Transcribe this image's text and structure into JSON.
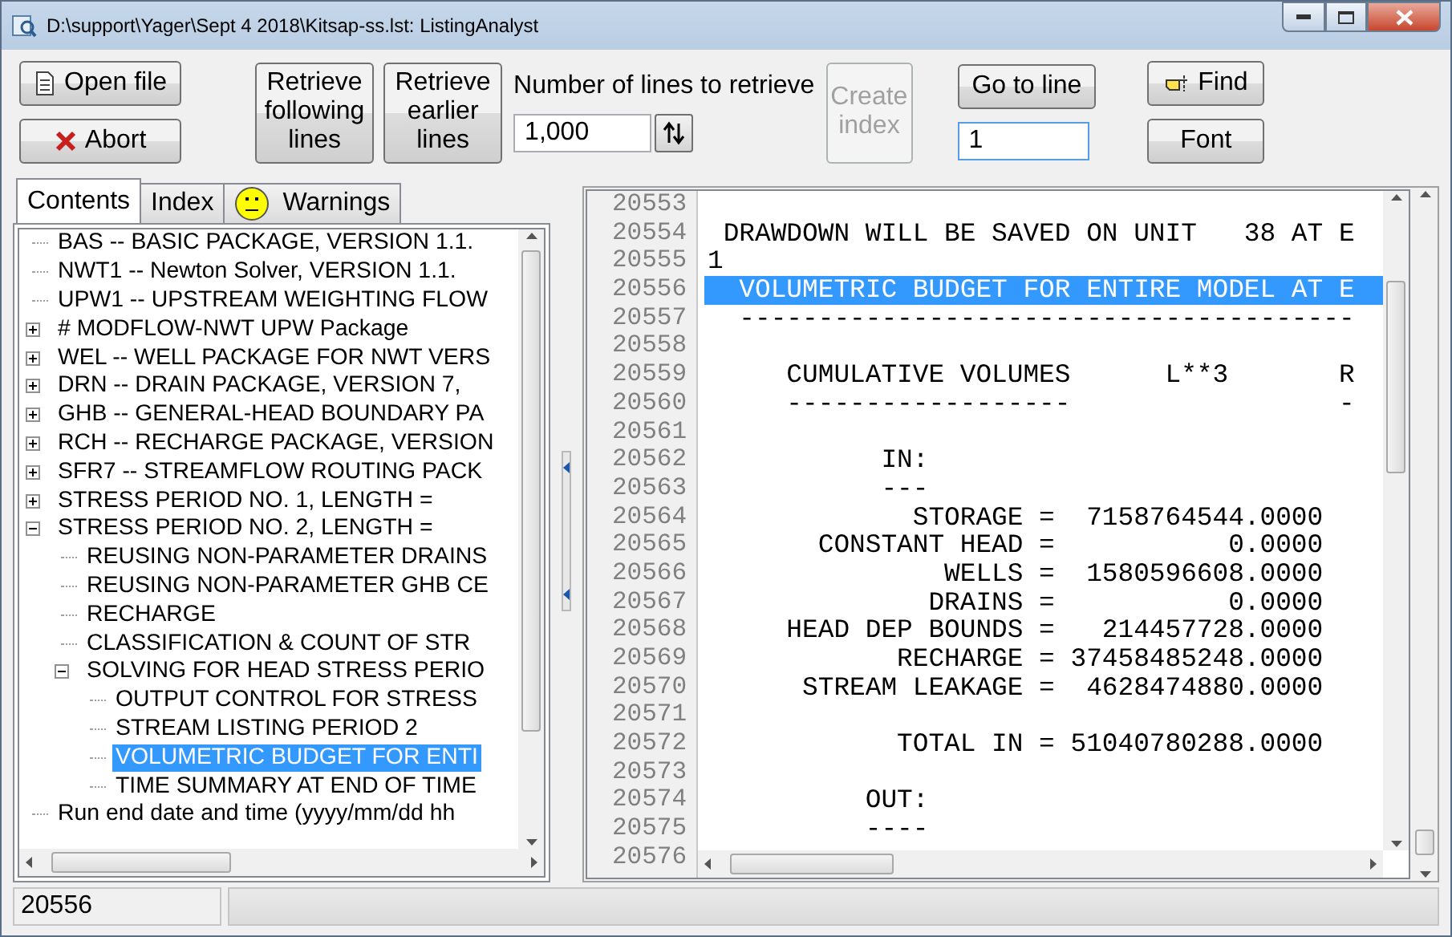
{
  "window": {
    "title": "D:\\support\\Yager\\Sept 4 2018\\Kitsap-ss.lst: ListingAnalyst"
  },
  "toolbar": {
    "open_file": "Open file",
    "abort": "Abort",
    "retrieve_following": "Retrieve following lines",
    "retrieve_earlier": "Retrieve earlier lines",
    "lines_to_retrieve": {
      "label": "Number of lines to retrieve",
      "value": "1,000"
    },
    "create_index": {
      "label": "Create index",
      "disabled": true
    },
    "go_to_line": {
      "label": "Go to line",
      "value": "1"
    },
    "find": "Find",
    "font": "Font"
  },
  "tabs": [
    {
      "label": "Contents",
      "selected": true,
      "kind": "plain"
    },
    {
      "label": "Index",
      "selected": false,
      "kind": "plain"
    },
    {
      "label": "Warnings",
      "selected": false,
      "kind": "smiley"
    }
  ],
  "tree": [
    {
      "label": "BAS -- BASIC PACKAGE, VERSION 1.1.",
      "kind": "leaf",
      "selected": false
    },
    {
      "label": "NWT1 -- Newton Solver, VERSION 1.1.",
      "kind": "leaf",
      "selected": false
    },
    {
      "label": "UPW1 -- UPSTREAM WEIGHTING FLOW",
      "kind": "leaf",
      "selected": false
    },
    {
      "label": "# MODFLOW-NWT UPW Package",
      "kind": "folder",
      "expanded": false,
      "selected": false
    },
    {
      "label": "WEL -- WELL PACKAGE FOR NWT VERS",
      "kind": "folder",
      "expanded": false,
      "selected": false
    },
    {
      "label": "DRN -- DRAIN PACKAGE, VERSION 7,",
      "kind": "folder",
      "expanded": false,
      "selected": false
    },
    {
      "label": "GHB -- GENERAL-HEAD BOUNDARY PA",
      "kind": "folder",
      "expanded": false,
      "selected": false
    },
    {
      "label": "RCH -- RECHARGE PACKAGE, VERSION",
      "kind": "folder",
      "expanded": false,
      "selected": false
    },
    {
      "label": "SFR7 -- STREAMFLOW ROUTING PACK",
      "kind": "folder",
      "expanded": false,
      "selected": false
    },
    {
      "label": "STRESS PERIOD NO.    1, LENGTH =",
      "kind": "folder",
      "expanded": false,
      "selected": false
    },
    {
      "label": "STRESS PERIOD NO.    2, LENGTH =",
      "kind": "folder",
      "expanded": true,
      "selected": false,
      "children": [
        {
          "label": "REUSING NON-PARAMETER DRAINS",
          "kind": "leaf",
          "selected": false
        },
        {
          "label": "REUSING NON-PARAMETER GHB CE",
          "kind": "leaf",
          "selected": false
        },
        {
          "label": "RECHARGE",
          "kind": "leaf",
          "selected": false
        },
        {
          "label": "CLASSIFICATION & COUNT OF STR",
          "kind": "leaf",
          "selected": false
        },
        {
          "label": "SOLVING FOR HEAD STRESS PERIO",
          "kind": "folder",
          "expanded": true,
          "selected": false,
          "children": [
            {
              "label": "OUTPUT CONTROL FOR STRESS",
              "kind": "leaf",
              "selected": false
            },
            {
              "label": "STREAM LISTING     PERIOD      2",
              "kind": "leaf",
              "selected": false
            },
            {
              "label": "VOLUMETRIC BUDGET FOR ENTI",
              "kind": "leaf",
              "selected": true
            },
            {
              "label": "TIME SUMMARY AT END OF TIME",
              "kind": "leaf",
              "selected": false
            }
          ]
        }
      ]
    },
    {
      "label": "Run end date and time (yyyy/mm/dd hh",
      "kind": "leaf",
      "selected": false
    }
  ],
  "listing": [
    {
      "number": "20553",
      "selected": false
    },
    {
      "number": "20554",
      "text": " DRAWDOWN WILL BE SAVED ON UNIT   38 AT E",
      "selected": false
    },
    {
      "number": "20555",
      "text": "1",
      "selected": false
    },
    {
      "number": "20556",
      "text": "  VOLUMETRIC BUDGET FOR ENTIRE MODEL AT E",
      "selected": true
    },
    {
      "number": "20557",
      "text": "  ---------------------------------------",
      "selected": false
    },
    {
      "number": "20558",
      "selected": false
    },
    {
      "number": "20559",
      "text": "     CUMULATIVE VOLUMES      L**3       R",
      "selected": false
    },
    {
      "number": "20560",
      "text": "     ------------------                 -",
      "selected": false
    },
    {
      "number": "20561",
      "selected": false
    },
    {
      "number": "20562",
      "text": "           IN:",
      "selected": false
    },
    {
      "number": "20563",
      "text": "           ---",
      "selected": false
    },
    {
      "number": "20564",
      "text": "             STORAGE =  7158764544.0000",
      "selected": false
    },
    {
      "number": "20565",
      "text": "       CONSTANT HEAD =           0.0000",
      "selected": false
    },
    {
      "number": "20566",
      "text": "               WELLS =  1580596608.0000",
      "selected": false
    },
    {
      "number": "20567",
      "text": "              DRAINS =           0.0000",
      "selected": false
    },
    {
      "number": "20568",
      "text": "     HEAD DEP BOUNDS =   214457728.0000",
      "selected": false
    },
    {
      "number": "20569",
      "text": "            RECHARGE = 37458485248.0000",
      "selected": false
    },
    {
      "number": "20570",
      "text": "      STREAM LEAKAGE =  4628474880.0000",
      "selected": false
    },
    {
      "number": "20571",
      "selected": false
    },
    {
      "number": "20572",
      "text": "            TOTAL IN = 51040780288.0000",
      "selected": false
    },
    {
      "number": "20573",
      "selected": false
    },
    {
      "number": "20574",
      "text": "          OUT:",
      "selected": false
    },
    {
      "number": "20575",
      "text": "          ----",
      "selected": false
    },
    {
      "number": "20576",
      "selected": false
    }
  ],
  "status_bar": {
    "line": "20556"
  }
}
